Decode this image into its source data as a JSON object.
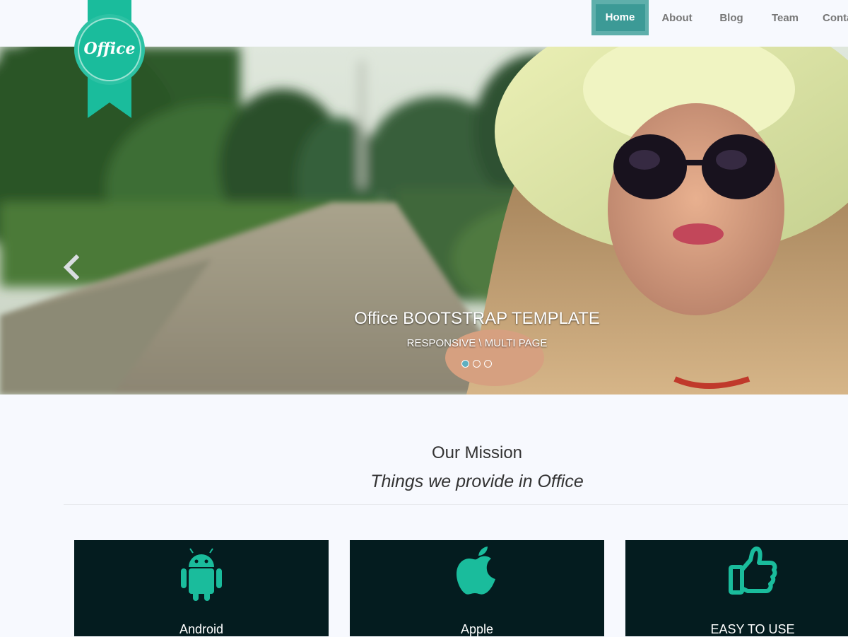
{
  "nav": {
    "items": [
      {
        "label": "Home",
        "active": true
      },
      {
        "label": "About",
        "active": false
      },
      {
        "label": "Blog",
        "active": false
      },
      {
        "label": "Team",
        "active": false
      },
      {
        "label": "Contact",
        "active": false
      }
    ]
  },
  "logo": {
    "text": "Office"
  },
  "hero": {
    "title": "Office BOOTSTRAP TEMPLATE",
    "subtitle": "RESPONSIVE \\ MULTI PAGE",
    "prev_icon": "chevron-left-icon",
    "slides_count": 3,
    "active_slide": 1
  },
  "mission": {
    "title": "Our Mission",
    "subtitle": "Things we provide in Office"
  },
  "features": [
    {
      "label": "Android",
      "icon": "android-icon"
    },
    {
      "label": "Apple",
      "icon": "apple-icon"
    },
    {
      "label": "EASY TO USE",
      "icon": "thumbs-up-icon"
    }
  ],
  "colors": {
    "accent": "#1abc9c",
    "nav_active": "#3c9a96",
    "card_bg": "#041c1f",
    "page_bg": "#f7f9fe"
  }
}
